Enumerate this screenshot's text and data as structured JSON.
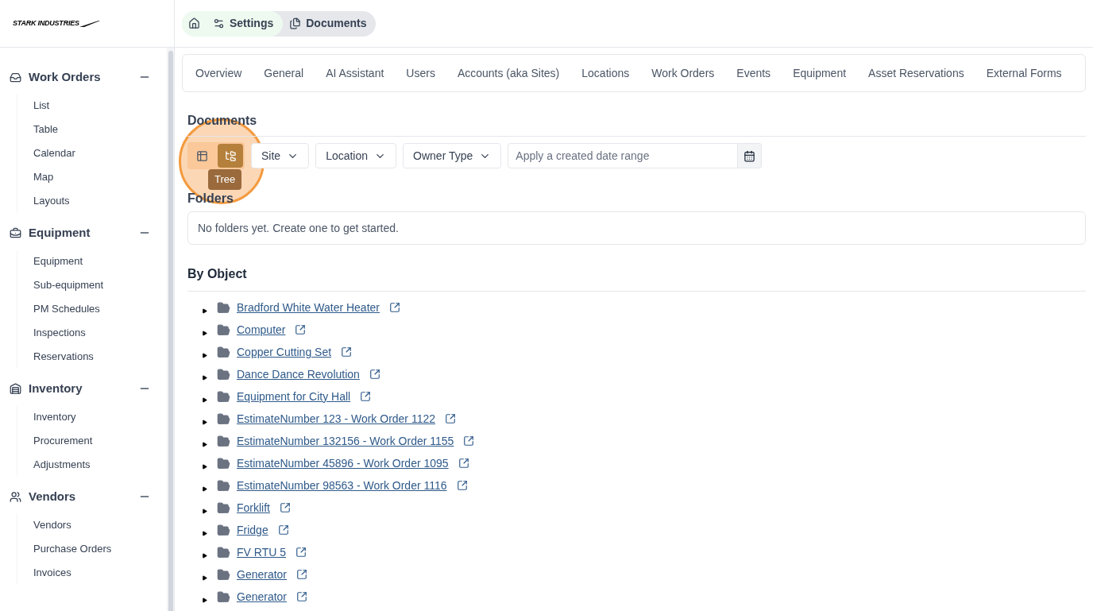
{
  "logo": {
    "text": "STARK INDUSTRIES"
  },
  "breadcrumb": [
    {
      "label": "Settings",
      "kind": "settings"
    },
    {
      "label": "Documents",
      "kind": "documents"
    }
  ],
  "sidebar": {
    "sections": [
      {
        "title": "Work Orders",
        "kind": "inbox",
        "expanded": true,
        "items": [
          "List",
          "Table",
          "Calendar",
          "Map",
          "Layouts"
        ]
      },
      {
        "title": "Equipment",
        "kind": "toolbox",
        "expanded": true,
        "items": [
          "Equipment",
          "Sub-equipment",
          "PM Schedules",
          "Inspections",
          "Reservations"
        ]
      },
      {
        "title": "Inventory",
        "kind": "warehouse",
        "expanded": true,
        "items": [
          "Inventory",
          "Procurement",
          "Adjustments"
        ]
      },
      {
        "title": "Vendors",
        "kind": "people",
        "expanded": true,
        "items": [
          "Vendors",
          "Purchase Orders",
          "Invoices"
        ]
      }
    ]
  },
  "tabs": [
    {
      "label": "Overview",
      "selected": false
    },
    {
      "label": "General",
      "selected": false
    },
    {
      "label": "AI Assistant",
      "selected": false
    },
    {
      "label": "Users",
      "selected": false
    },
    {
      "label": "Accounts (aka Sites)",
      "selected": false
    },
    {
      "label": "Locations",
      "selected": false
    },
    {
      "label": "Work Orders",
      "selected": false
    },
    {
      "label": "Events",
      "selected": false
    },
    {
      "label": "Equipment",
      "selected": false
    },
    {
      "label": "Asset Reservations",
      "selected": false
    },
    {
      "label": "External Forms",
      "selected": false
    }
  ],
  "page_title": "Documents",
  "view_toggle": [
    {
      "kind": "table",
      "selected": false
    },
    {
      "kind": "tree",
      "selected": true
    }
  ],
  "tooltip": "Tree",
  "filters": [
    "Site",
    "Location",
    "Owner Type"
  ],
  "date_range": {
    "placeholder": "Apply a created date range"
  },
  "folders": {
    "title": "Folders",
    "empty_message": "No folders yet. Create one to get started."
  },
  "by_object": {
    "title": "By Object",
    "items": [
      {
        "label": "Bradford White Water Heater",
        "expanded": false
      },
      {
        "label": "Computer",
        "expanded": false
      },
      {
        "label": "Copper Cutting Set",
        "expanded": false
      },
      {
        "label": "Dance Dance Revolution",
        "expanded": false
      },
      {
        "label": "Equipment for City Hall",
        "expanded": false
      },
      {
        "label": "EstimateNumber 123 - Work Order 1122",
        "expanded": false
      },
      {
        "label": "EstimateNumber 132156 - Work Order 1155",
        "expanded": false
      },
      {
        "label": "EstimateNumber 45896 - Work Order 1095",
        "expanded": false
      },
      {
        "label": "EstimateNumber 98563 - Work Order 1116",
        "expanded": false
      },
      {
        "label": "Forklift",
        "expanded": false
      },
      {
        "label": "Fridge",
        "expanded": false
      },
      {
        "label": "FV RTU 5",
        "expanded": false
      },
      {
        "label": "Generator",
        "expanded": false
      },
      {
        "label": "Generator",
        "expanded": false
      }
    ]
  }
}
